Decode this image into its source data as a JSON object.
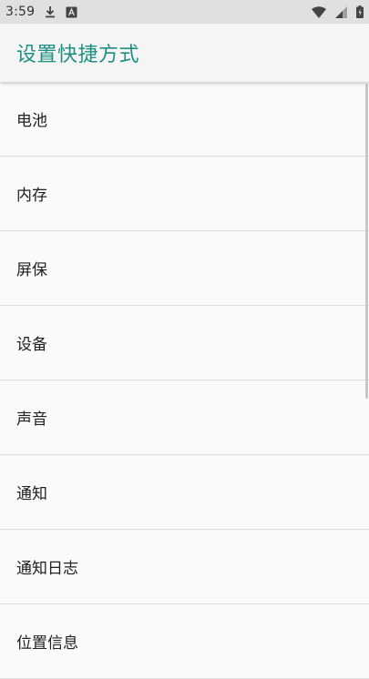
{
  "status_bar": {
    "time": "3:59",
    "icons": [
      "download-icon",
      "a-badge-icon",
      "wifi-icon",
      "signal-icon",
      "battery-icon"
    ]
  },
  "app_bar": {
    "title": "设置快捷方式"
  },
  "list": {
    "items": [
      {
        "label": "电池"
      },
      {
        "label": "内存"
      },
      {
        "label": "屏保"
      },
      {
        "label": "设备"
      },
      {
        "label": "声音"
      },
      {
        "label": "通知"
      },
      {
        "label": "通知日志"
      },
      {
        "label": "位置信息"
      }
    ]
  },
  "colors": {
    "accent": "#1f8f81",
    "status_bar_bg": "#e0e0e0",
    "app_bar_bg": "#f5f5f5",
    "list_bg": "#fafafa",
    "divider": "#dedede",
    "text": "#212121"
  }
}
